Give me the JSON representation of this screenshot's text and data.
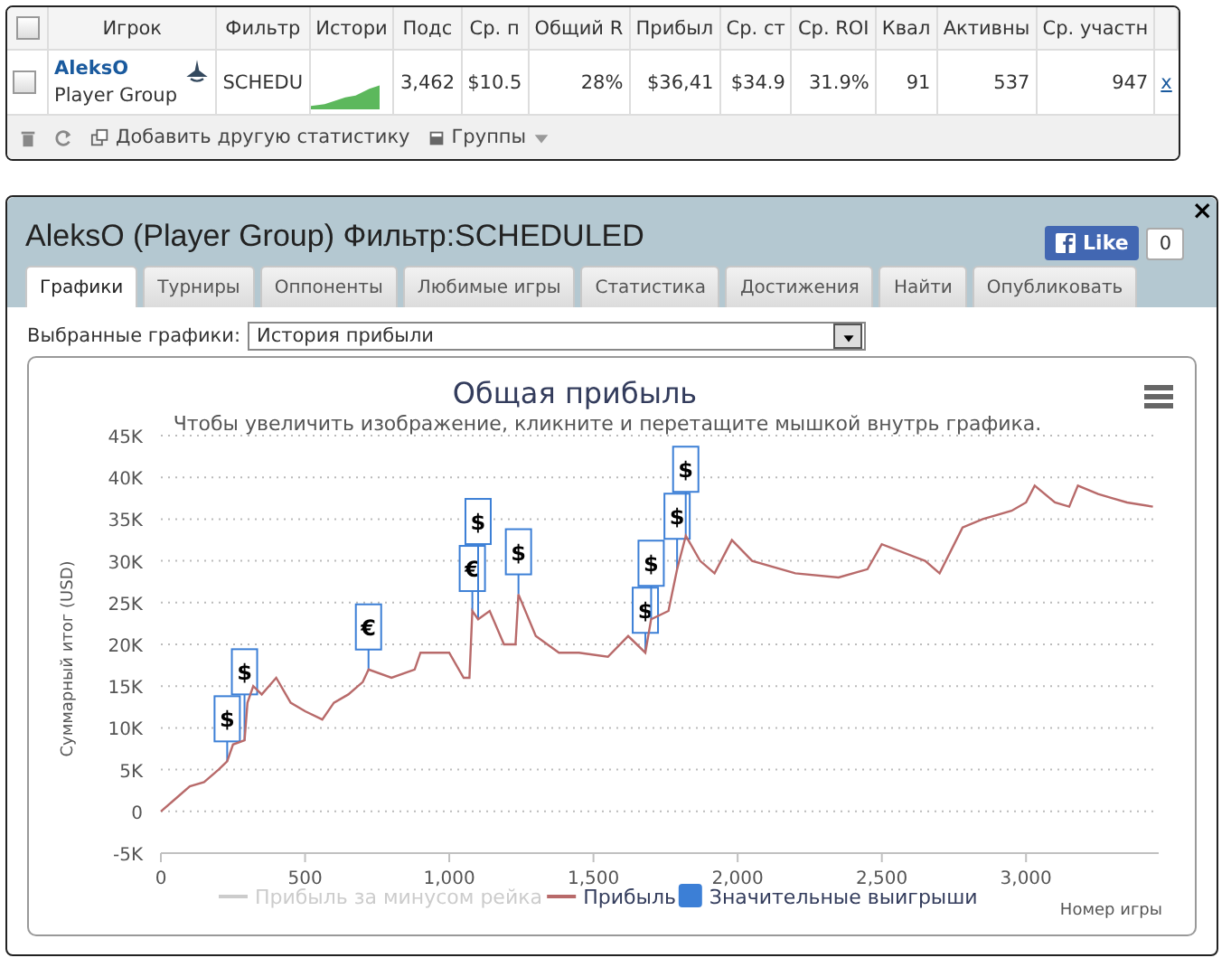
{
  "stats_table": {
    "columns": [
      "Игрок",
      "Фильтр",
      "Истори",
      "Подс",
      "Ср. п",
      "Общий R",
      "Прибыл",
      "Ср. ст",
      "Ср. ROI",
      "Квал",
      "Активны",
      "Ср. участн"
    ],
    "rows": [
      {
        "checked": false,
        "cells": [
          "AleksO",
          "SCHEDU",
          "",
          "3,462",
          "$10.5",
          "28%",
          "$36,41",
          "$34.9",
          "31.9%",
          "91",
          "537",
          "947"
        ],
        "group": "Player Group",
        "remove": "x"
      }
    ],
    "header_checked": false,
    "toolbar": {
      "add": "Добавить другую статистику",
      "groups": "Группы"
    }
  },
  "dialog": {
    "title": "AleksO (Player Group) Фильтр:SCHEDULED",
    "like": "Like",
    "like_count": "0",
    "close": "×",
    "tabs": [
      {
        "label": "Графики",
        "selected": true
      },
      {
        "label": "Турниры",
        "selected": false
      },
      {
        "label": "Оппоненты",
        "selected": false
      },
      {
        "label": "Любимые игры",
        "selected": false
      },
      {
        "label": "Статистика",
        "selected": false
      },
      {
        "label": "Достижения",
        "selected": false
      },
      {
        "label": "Найти",
        "selected": false
      },
      {
        "label": "Опубликовать",
        "selected": false
      }
    ],
    "select_label": "Выбранные графики:",
    "select_value": "История прибыли",
    "chart": {
      "subtitle": "Чтобы увеличить изображение, кликните и перетащите мышкой внутрь графика.",
      "hidden_series": [
        {
          "label": "Прибыль за минусом рейка",
          "enabled": false
        }
      ],
      "flags_legend": {
        "label": "Значительные выигрыши",
        "color": "#3c7fd6"
      },
      "chart_data": {
        "type": "line",
        "grid": true,
        "title": "Общая прибыль",
        "xlabel": "Номер игры",
        "ylabel": "Суммарный итог (USD)",
        "xlim": [
          0,
          3460
        ],
        "ylim": [
          -5000,
          45000
        ],
        "xticks": [
          {
            "value": 0,
            "label": "0"
          },
          {
            "value": 500,
            "label": "500"
          },
          {
            "value": 1000,
            "label": "1,000"
          },
          {
            "value": 1500,
            "label": "1,500"
          },
          {
            "value": 2000,
            "label": "2,000"
          },
          {
            "value": 2500,
            "label": "2,500"
          },
          {
            "value": 3000,
            "label": "3,000"
          }
        ],
        "yticks": [
          {
            "value": -5000,
            "label": "-5K"
          },
          {
            "value": 0,
            "label": "0"
          },
          {
            "value": 5000,
            "label": "5K"
          },
          {
            "value": 10000,
            "label": "10K"
          },
          {
            "value": 15000,
            "label": "15K"
          },
          {
            "value": 20000,
            "label": "20K"
          },
          {
            "value": 25000,
            "label": "25K"
          },
          {
            "value": 30000,
            "label": "30K"
          },
          {
            "value": 35000,
            "label": "35K"
          },
          {
            "value": 40000,
            "label": "40K"
          },
          {
            "value": 45000,
            "label": "45K"
          }
        ],
        "x": [
          0,
          50,
          100,
          150,
          200,
          230,
          250,
          290,
          300,
          320,
          350,
          400,
          450,
          500,
          560,
          600,
          650,
          700,
          720,
          800,
          880,
          900,
          1000,
          1050,
          1070,
          1080,
          1100,
          1140,
          1190,
          1230,
          1240,
          1300,
          1380,
          1450,
          1550,
          1620,
          1680,
          1700,
          1760,
          1790,
          1820,
          1870,
          1920,
          1980,
          2050,
          2200,
          2350,
          2450,
          2500,
          2650,
          2700,
          2780,
          2850,
          2950,
          3000,
          3030,
          3100,
          3150,
          3180,
          3250,
          3300,
          3350,
          3440
        ],
        "series": [
          {
            "name": "Прибыль",
            "color": "#b86a6a",
            "values": [
              0,
              1500,
              3000,
              3500,
              5000,
              6000,
              8000,
              8500,
              13000,
              15000,
              14000,
              16000,
              13000,
              12000,
              11000,
              13000,
              14000,
              15500,
              17000,
              16000,
              17000,
              19000,
              19000,
              16000,
              16000,
              24000,
              23000,
              24000,
              20000,
              20000,
              26000,
              21000,
              19000,
              19000,
              18500,
              21000,
              19000,
              23000,
              24000,
              29000,
              33000,
              30000,
              28500,
              32500,
              30000,
              28500,
              28000,
              29000,
              32000,
              30000,
              28500,
              34000,
              35000,
              36000,
              37000,
              39000,
              37000,
              36500,
              39000,
              38000,
              37500,
              37000,
              36500
            ]
          }
        ],
        "annotations": [
          {
            "x": 230,
            "y": 6000,
            "text": "$"
          },
          {
            "x": 290,
            "y": 8500,
            "text": "$"
          },
          {
            "x": 720,
            "y": 17000,
            "text": "€"
          },
          {
            "x": 1080,
            "y": 24000,
            "text": "€"
          },
          {
            "x": 1100,
            "y": 23000,
            "text": "$"
          },
          {
            "x": 1240,
            "y": 26000,
            "text": "$"
          },
          {
            "x": 1680,
            "y": 19000,
            "text": "$"
          },
          {
            "x": 1700,
            "y": 23000,
            "text": "$"
          },
          {
            "x": 1790,
            "y": 29000,
            "text": "$"
          },
          {
            "x": 1820,
            "y": 33000,
            "text": "$"
          }
        ]
      }
    }
  }
}
